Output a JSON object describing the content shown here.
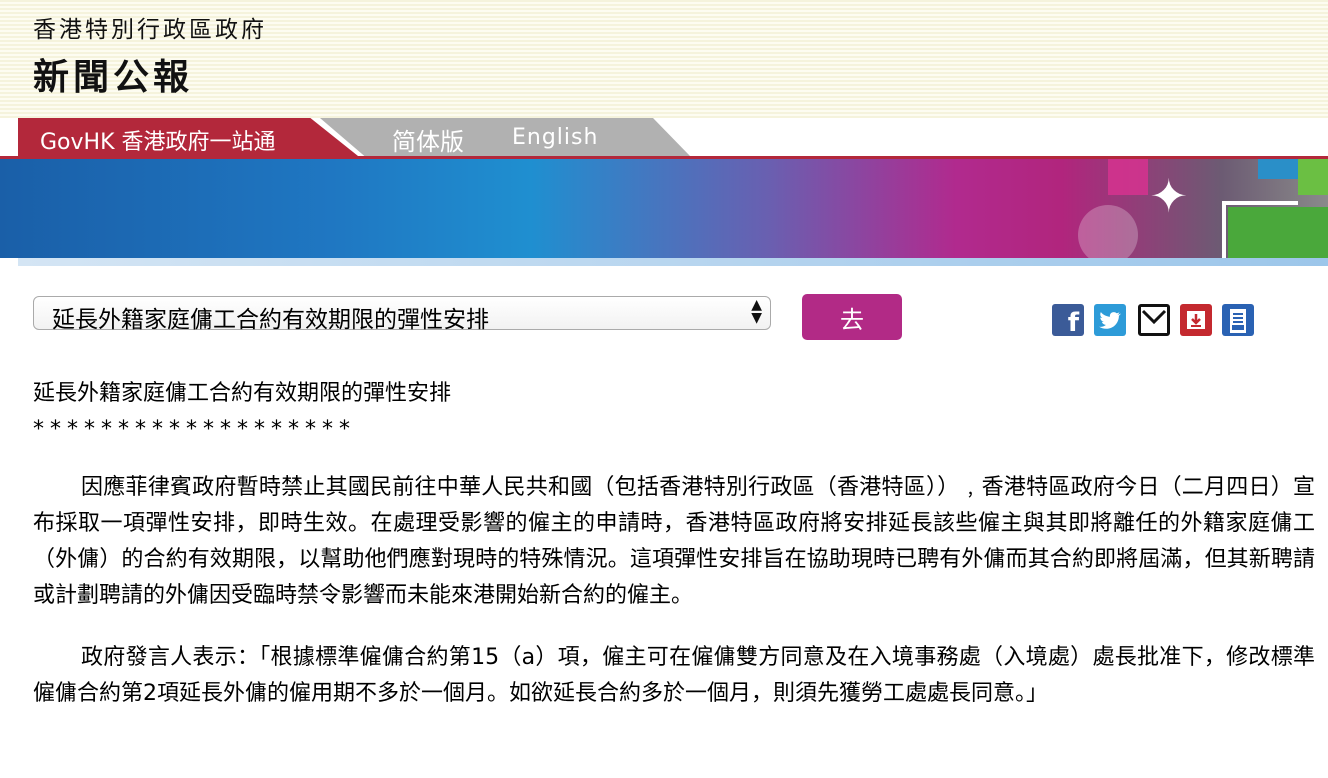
{
  "header": {
    "gov_name": "香港特別行政區政府",
    "press_release": "新聞公報"
  },
  "tabs": {
    "govhk": "GovHK 香港政府一站通",
    "simplified": "简体版",
    "english": "English"
  },
  "selector": {
    "selected": "延長外籍家庭傭工合約有效期限的彈性安排",
    "go_label": "去"
  },
  "share_icons": [
    "facebook-icon",
    "twitter-icon",
    "email-icon",
    "pdf-icon",
    "print-icon"
  ],
  "article": {
    "title": "延長外籍家庭傭工合約有效期限的彈性安排",
    "stars": "*******************",
    "para1": "因應菲律賓政府暫時禁止其國民前往中華人民共和國（包括香港特別行政區（香港特區））﹐香港特區政府今日（二月四日）宣布採取一項彈性安排，即時生效。在處理受影響的僱主的申請時，香港特區政府將安排延長該些僱主與其即將離任的外籍家庭傭工（外傭）的合約有效期限，以幫助他們應對現時的特殊情況。這項彈性安排旨在協助現時已聘有外傭而其合約即將屆滿，但其新聘請或計劃聘請的外傭因受臨時禁令影響而未能來港開始新合約的僱主。",
    "para2": "政府發言人表示：「根據標準僱傭合約第15（a）項，僱主可在僱傭雙方同意及在入境事務處（入境處）處長批准下，修改標準僱傭合約第2項延長外傭的僱用期不多於一個月。如欲延長合約多於一個月，則須先獲勞工處處長同意。」"
  }
}
